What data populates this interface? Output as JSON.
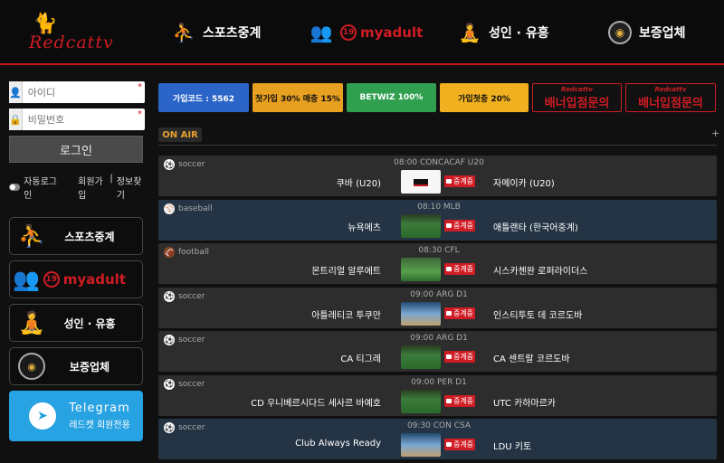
{
  "header": {
    "logo_text": "Redcattv",
    "nav": [
      {
        "label": "스포츠중계",
        "icon": "soccer-player-icon"
      },
      {
        "label": "myadult",
        "prefix": "19",
        "icon": "couple-silhouette-icon"
      },
      {
        "label": "성인 · 유흥",
        "icon": "massage-icon"
      },
      {
        "label": "보증업체",
        "icon": "guarantee-badge-icon"
      }
    ]
  },
  "sidebar": {
    "id_placeholder": "아이디",
    "pw_placeholder": "비밀번호",
    "login_label": "로그인",
    "auto_login": "자동로그인",
    "signup": "회원가입",
    "separator": "|",
    "find_info": "정보찾기",
    "menu": [
      {
        "label": "스포츠중계"
      },
      {
        "label": "myadult",
        "prefix": "19"
      },
      {
        "label": "성인 · 유흥"
      },
      {
        "label": "보증업체"
      }
    ],
    "telegram": {
      "title": "Telegram",
      "subtitle": "레드캣 회원전용"
    }
  },
  "banners": [
    {
      "text": "가입코드 : 5562"
    },
    {
      "text": "첫가입 30% 매충 15%"
    },
    {
      "text": "BETWIZ 100%"
    },
    {
      "text": "가입첫충 20%"
    },
    {
      "text": "배너입점문의",
      "brand": "Redcattv"
    },
    {
      "text": "배너입점문의",
      "brand": "Redcattv"
    }
  ],
  "section": {
    "title": "ON AIR",
    "more": "+"
  },
  "live_label": "중계중",
  "games": [
    {
      "sport": "soccer",
      "meta": "08:00 CONCACAF U20",
      "home": "쿠바 (U20)",
      "away": "자메이카 (U20)",
      "thumb": "black"
    },
    {
      "sport": "baseball",
      "meta": "08:10 MLB",
      "home": "뉴욕메츠",
      "away": "애틀랜타 (한국어중계)",
      "thumb": "field"
    },
    {
      "sport": "football",
      "meta": "08:30 CFL",
      "home": "몬트리얼 알루에트",
      "away": "시스카첸완 로퍼라이더스",
      "thumb": "foot"
    },
    {
      "sport": "soccer",
      "meta": "09:00 ARG D1",
      "home": "아틀레티코 투쿠만",
      "away": "인스티투토 데 코르도바",
      "thumb": "court"
    },
    {
      "sport": "soccer",
      "meta": "09:00 ARG D1",
      "home": "CA 티그레",
      "away": "CA 센트랄 코르도바",
      "thumb": "field"
    },
    {
      "sport": "soccer",
      "meta": "09:00 PER D1",
      "home": "CD 우니베르시다드 세사르 바예호",
      "away": "UTC 카하마르카",
      "thumb": "field"
    },
    {
      "sport": "soccer",
      "meta": "09:30 CON CSA",
      "home": "Club Always Ready",
      "away": "LDU 키토",
      "thumb": "court"
    }
  ]
}
